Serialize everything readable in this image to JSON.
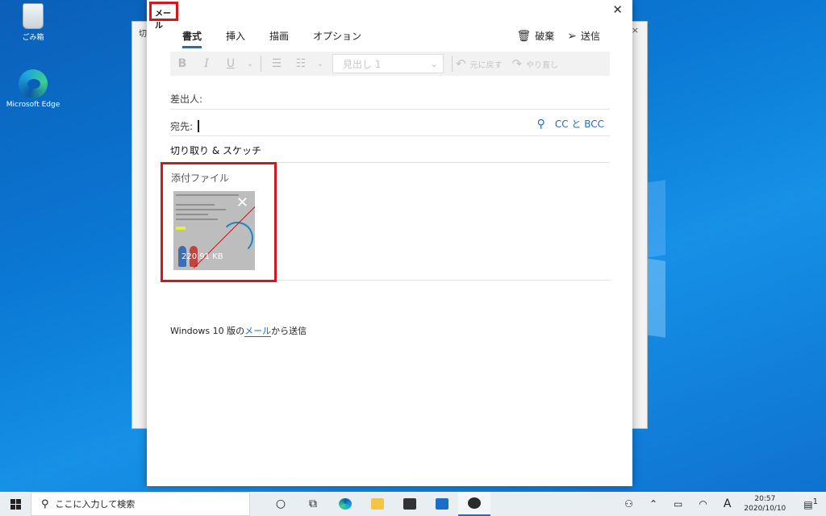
{
  "desktop": {
    "icons": [
      {
        "label": "ごみ箱"
      },
      {
        "label": "Microsoft Edge"
      }
    ]
  },
  "background_window": {
    "title_fragment": "切",
    "close": "×"
  },
  "mail": {
    "window_title": "メール",
    "close_glyph": "✕",
    "tabs": [
      "書式",
      "挿入",
      "描画",
      "オプション"
    ],
    "active_tab": 0,
    "actions": {
      "discard": "破棄",
      "send": "送信"
    },
    "toolbar": {
      "bold": "B",
      "italic": "I",
      "underline": "U",
      "heading_placeholder": "見出し 1",
      "undo": "元に戻す",
      "redo": "やり直し"
    },
    "from_label": "差出人:",
    "to_label": "宛先:",
    "cc_bcc": "CC と BCC",
    "subject": "切り取り & スケッチ",
    "attachments_label": "添付ファイル",
    "attachment": {
      "size": "220.91 KB"
    },
    "signature": {
      "prefix": "Windows 10 版の",
      "link": "メール",
      "suffix": "から送信"
    }
  },
  "taskbar": {
    "search_placeholder": "ここに入力して検索",
    "ime": "A",
    "time": "20:57",
    "date": "2020/10/10",
    "notification_count": "1"
  },
  "colors": {
    "accent": "#1a6fc4",
    "highlight_frame": "#d6151c",
    "desktop": "#0a78d4"
  }
}
